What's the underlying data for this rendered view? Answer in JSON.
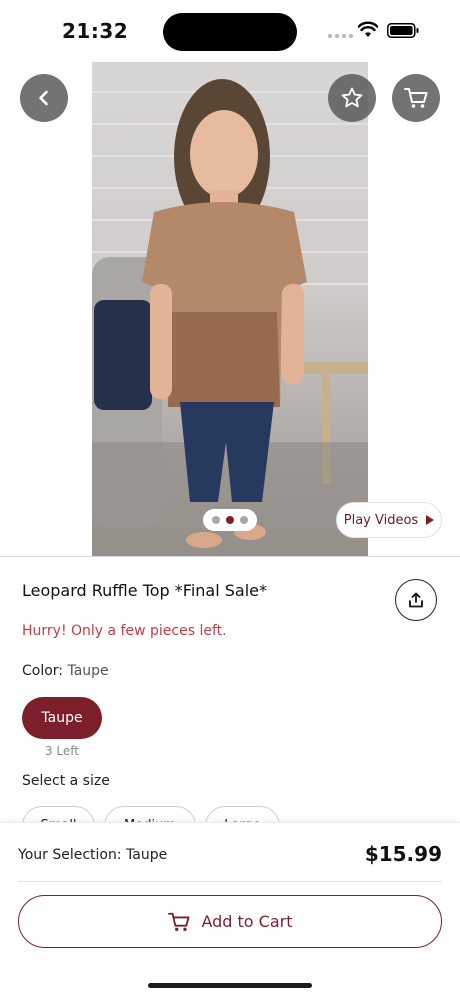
{
  "status_bar": {
    "time": "21:32"
  },
  "media": {
    "play_videos_label": "Play Videos",
    "carousel": {
      "count": 3,
      "active_index": 1
    }
  },
  "product": {
    "title": "Leopard Ruffle Top *Final Sale*",
    "urgency": "Hurry! Only a few pieces left.",
    "color_label": "Color:",
    "color_value": "Taupe",
    "swatch_label": "Taupe",
    "stock_label": "3 Left",
    "size_label": "Select a size",
    "sizes": [
      "Small",
      "Medium",
      "Large"
    ]
  },
  "bottom": {
    "selection": "Your Selection: Taupe",
    "price": "$15.99",
    "add_to_cart": "Add to Cart"
  },
  "colors": {
    "accent": "#7d1f2a",
    "urgency": "#c83a44"
  },
  "icons": [
    "chevron-left-icon",
    "star-icon",
    "cart-icon",
    "share-icon",
    "play-icon",
    "cart-outline-icon",
    "wifi-icon",
    "battery-icon"
  ]
}
